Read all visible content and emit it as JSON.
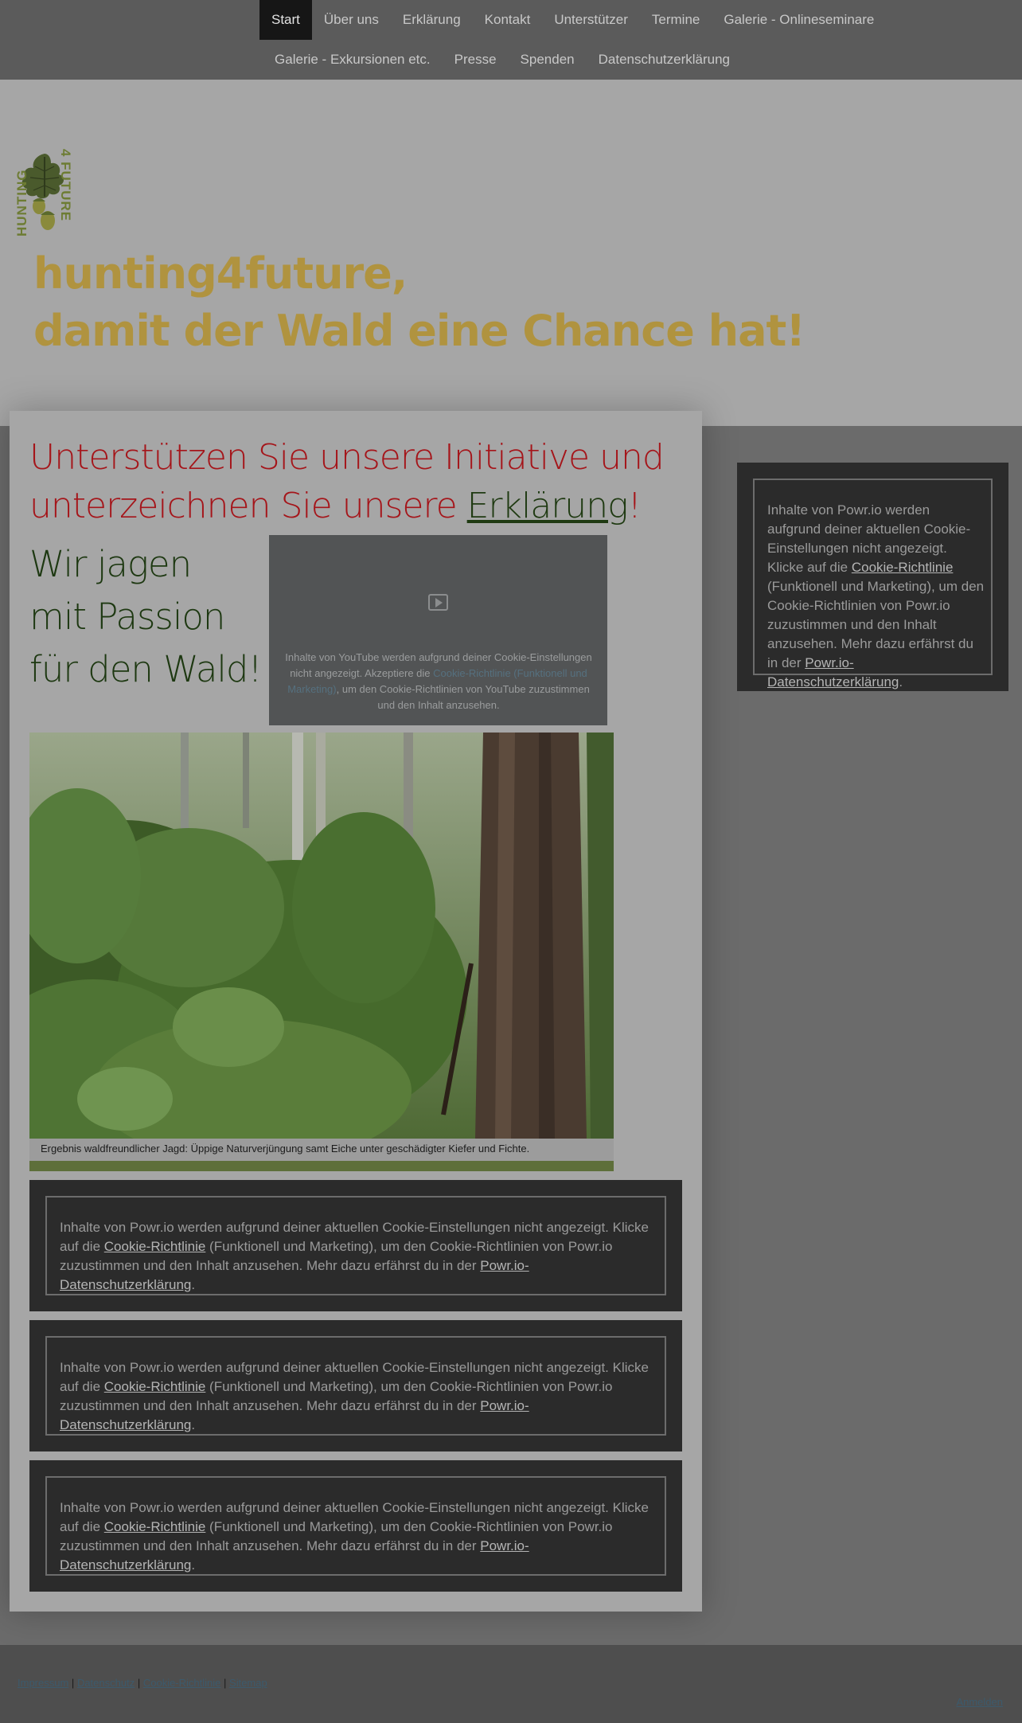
{
  "nav": {
    "row1": [
      "Start",
      "Über uns",
      "Erklärung",
      "Kontakt",
      "Unterstützer",
      "Termine",
      "Galerie - Onlineseminare"
    ],
    "row2": [
      "Galerie - Exkursionen etc.",
      "Presse",
      "Spenden",
      "Datenschutzerklärung"
    ],
    "active": "Start"
  },
  "header": {
    "logo_left": "HUNTING",
    "logo_right": "4 FUTURE",
    "headline_1": "hunting4future,",
    "headline_2": "damit der Wald eine Chance hat!"
  },
  "main": {
    "lead_prefix": "Unterstützen Sie unsere Initiative und unterzeichnen Sie unsere ",
    "lead_link": "Erklärung",
    "lead_suffix": "!",
    "passion_1": "Wir jagen",
    "passion_2": "mit Passion",
    "passion_3": "für den Wald!",
    "youtube": {
      "text_1": "Inhalte von YouTube werden aufgrund deiner Cookie-Einstellungen nicht angezeigt. Akzeptiere die ",
      "link": "Cookie-Richtlinie (Funktionell und Marketing)",
      "text_2": ", um den Cookie-Richtlinien von YouTube zuzustimmen und den Inhalt anzusehen."
    },
    "photo_caption": "Ergebnis waldfreundlicher Jagd: Üppige Naturverjüngung samt Eiche unter geschädigter Kiefer und Fichte.",
    "powr_notice": {
      "text_1": "Inhalte von Powr.io werden aufgrund deiner aktuellen Cookie-Einstellungen nicht angezeigt. Klicke auf die ",
      "link_1": "Cookie-Richtlinie",
      "text_2": " (Funktionell und Marketing), um den Cookie-Richtlinien von Powr.io zuzustimmen und den Inhalt anzusehen. Mehr dazu erfährst du in der ",
      "link_2": "Powr.io-Datenschutzerklärung",
      "text_3": "."
    }
  },
  "footer": {
    "links": [
      "Impressum",
      "Datenschutz",
      "Cookie-Richtlinie",
      "Sitemap"
    ],
    "separator": "|",
    "right_link": "Anmelden"
  },
  "colors": {
    "headline": "#b0933f",
    "lead": "#a5151a",
    "passion": "#1d3811",
    "nav_active_bg": "#161616"
  }
}
